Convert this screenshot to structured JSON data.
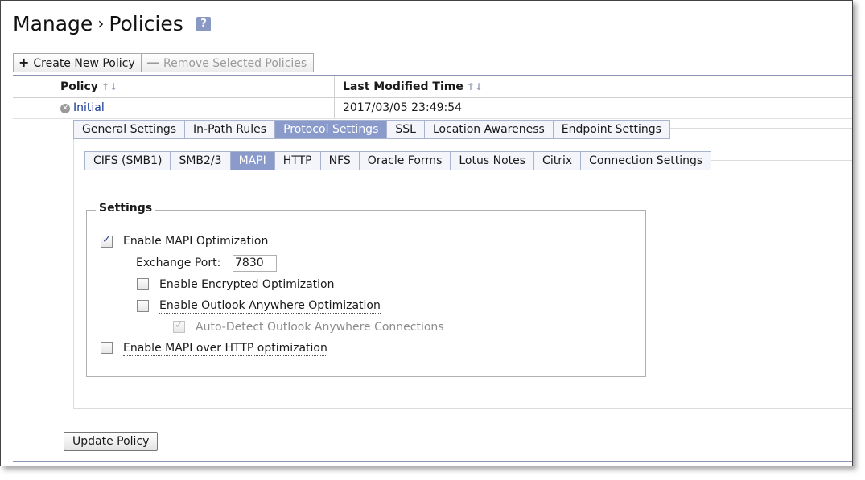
{
  "breadcrumb": {
    "section": "Manage",
    "separator": "›",
    "page": "Policies",
    "help": "?"
  },
  "toolbar": {
    "create_label": "Create New Policy",
    "create_icon": "+",
    "remove_label": "Remove Selected Policies",
    "remove_icon": "—"
  },
  "table": {
    "columns": [
      "Policy",
      "Last Modified Time"
    ],
    "sort_icon": "↑↓",
    "rows": [
      {
        "name": "Initial",
        "modified": "2017/03/05 23:49:54",
        "remove_icon": "✕"
      }
    ]
  },
  "tabs": [
    "General Settings",
    "In-Path Rules",
    "Protocol Settings",
    "SSL",
    "Location Awareness",
    "Endpoint Settings"
  ],
  "subtabs": [
    "CIFS (SMB1)",
    "SMB2/3",
    "MAPI",
    "HTTP",
    "NFS",
    "Oracle Forms",
    "Lotus Notes",
    "Citrix",
    "Connection Settings"
  ],
  "settings": {
    "legend": "Settings",
    "enable_mapi": {
      "label": "Enable MAPI Optimization",
      "checked": true
    },
    "exchange_port_label": "Exchange Port:",
    "exchange_port_value": "7830",
    "encrypted": {
      "label": "Enable Encrypted Optimization",
      "checked": false
    },
    "outlook_anywhere": {
      "label": "Enable Outlook Anywhere Optimization",
      "checked": false
    },
    "auto_detect": {
      "label": "Auto-Detect Outlook Anywhere Connections",
      "checked": true,
      "disabled": true
    },
    "mapi_http": {
      "label": "Enable MAPI over HTTP optimization",
      "checked": false
    }
  },
  "update_button": "Update Policy",
  "colors": {
    "accent": "#8a9acb",
    "link": "#1a3a9a",
    "grid": "#8a95b5"
  }
}
